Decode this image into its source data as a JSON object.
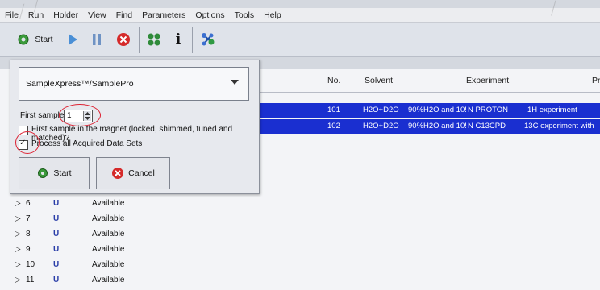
{
  "menu": [
    "File",
    "Run",
    "Holder",
    "View",
    "Find",
    "Parameters",
    "Options",
    "Tools",
    "Help"
  ],
  "toolbar": {
    "start_label": "Start",
    "info_label": "i"
  },
  "columns": {
    "no": "No.",
    "solvent": "Solvent",
    "experiment": "Experiment",
    "pr": "Pr"
  },
  "selected_rows": [
    {
      "no": "101",
      "solvent": "H2O+D2O",
      "desc": "90%H2O and 10!",
      "exp": "N PROTON",
      "extra": "1H experiment"
    },
    {
      "no": "102",
      "solvent": "H2O+D2O",
      "desc": "90%H2O and 10!",
      "exp": "N C13CPD",
      "extra": "13C experiment with"
    }
  ],
  "holder_rows": [
    {
      "num": "6",
      "status": "Available"
    },
    {
      "num": "7",
      "status": "Available"
    },
    {
      "num": "8",
      "status": "Available"
    },
    {
      "num": "9",
      "status": "Available"
    },
    {
      "num": "10",
      "status": "Available"
    },
    {
      "num": "11",
      "status": "Available"
    }
  ],
  "dialog": {
    "device_select": "SampleXpress™/SamplePro",
    "first_sample_label": "First sample",
    "first_sample_value": "1",
    "magnet_checkbox_label": "First sample in the magnet (locked, shimmed, tuned and matched)?",
    "magnet_checked": false,
    "process_checkbox_label": "Process all Acquired Data Sets",
    "process_checked": true,
    "start_button": "Start",
    "cancel_button": "Cancel"
  },
  "colors": {
    "selection": "#1a2fd0",
    "highlight_circle": "#dd2233"
  }
}
